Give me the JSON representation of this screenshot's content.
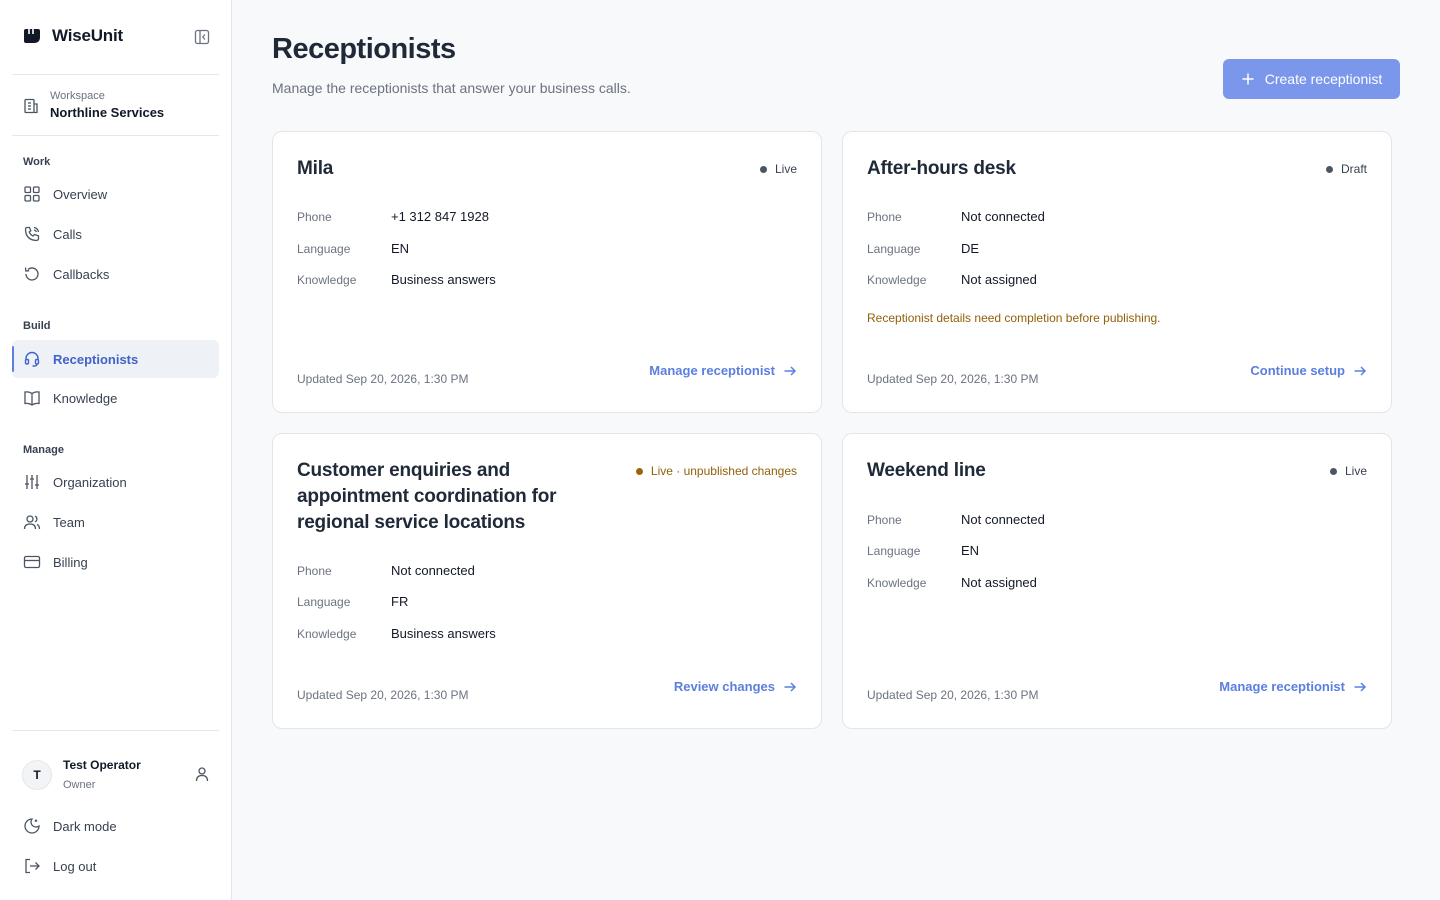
{
  "sidebar": {
    "brand": "WiseUnit",
    "workspace": {
      "label": "Workspace",
      "name": "Northline Services"
    },
    "sections": {
      "work": "Work",
      "build": "Build",
      "manage": "Manage"
    },
    "items": [
      {
        "label": "Overview",
        "icon": "grid-icon"
      },
      {
        "label": "Calls",
        "icon": "phone-icon"
      },
      {
        "label": "Callbacks",
        "icon": "refresh-icon"
      },
      {
        "label": "Receptionists",
        "icon": "headset-icon",
        "active": true
      },
      {
        "label": "Knowledge",
        "icon": "book-icon"
      },
      {
        "label": "Organization",
        "icon": "sliders-icon"
      },
      {
        "label": "Team",
        "icon": "users-icon"
      },
      {
        "label": "Billing",
        "icon": "credit-card-icon"
      }
    ],
    "user": {
      "initial": "T",
      "name": "Test Operator",
      "role": "Owner"
    },
    "dark_mode": "Dark mode",
    "logout": "Log out"
  },
  "main": {
    "title": "Receptionists",
    "subtitle": "Manage the receptionists that answer your business calls.",
    "create_button": "Create receptionist",
    "field_labels": {
      "phone": "Phone",
      "language": "Language",
      "knowledge": "Knowledge"
    },
    "cards": [
      {
        "name": "Mila",
        "status": "Live",
        "phone": "+1 312 847 1928",
        "language": "EN",
        "knowledge": "Business answers",
        "updated": "Updated Sep 20, 2026, 1:30 PM",
        "action": "Manage receptionist"
      },
      {
        "name": "After-hours desk",
        "status": "Draft",
        "phone": "Not connected",
        "language": "DE",
        "knowledge": "Not assigned",
        "note": "Receptionist details need completion before publishing.",
        "updated": "Updated Sep 20, 2026, 1:30 PM",
        "action": "Continue setup"
      },
      {
        "name": "Customer enquiries and appointment coordination for regional service locations",
        "status": "Live · unpublished changes",
        "phone": "Not connected",
        "language": "FR",
        "knowledge": "Business answers",
        "updated": "Updated Sep 20, 2026, 1:30 PM",
        "action": "Review changes"
      },
      {
        "name": "Weekend line",
        "status": "Live",
        "phone": "Not connected",
        "language": "EN",
        "knowledge": "Not assigned",
        "updated": "Updated Sep 20, 2026, 1:30 PM",
        "action": "Manage receptionist"
      }
    ]
  },
  "colors": {
    "accent": "#5b7fe0",
    "primary_button": "#7a97ec",
    "warning": "#92600a",
    "active_nav_bg": "#eef1f6"
  }
}
